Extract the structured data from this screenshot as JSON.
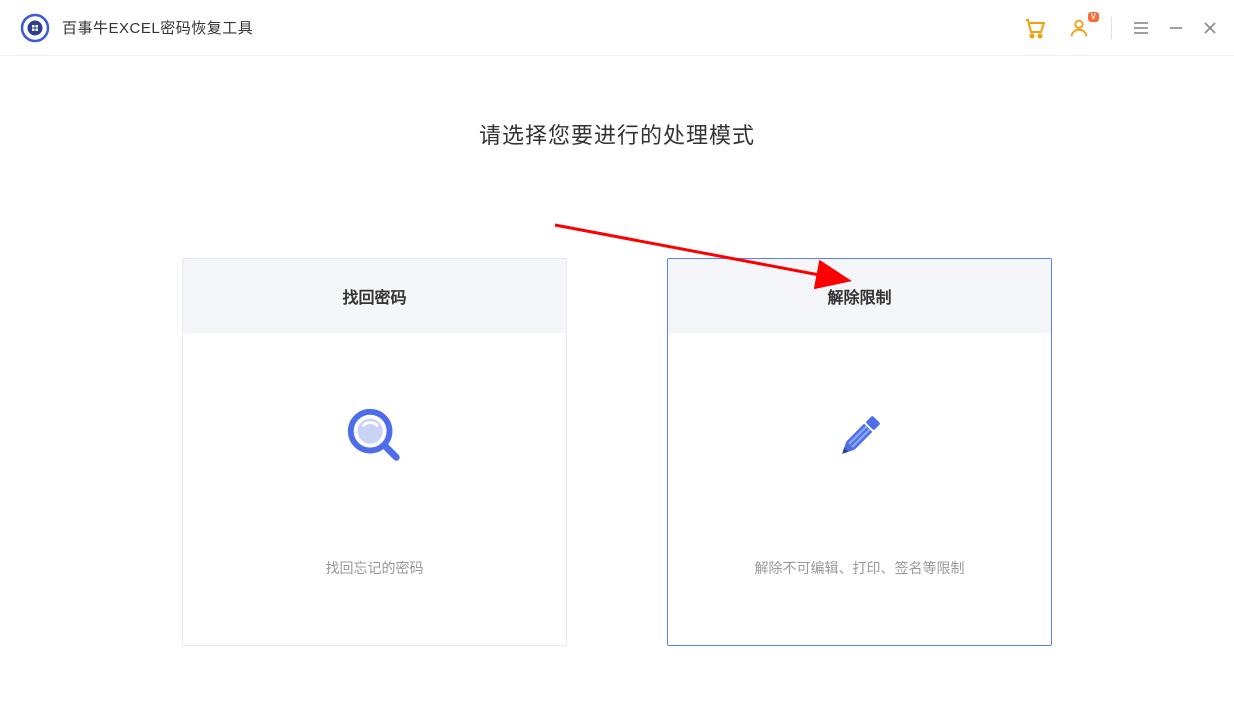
{
  "header": {
    "app_title": "百事牛EXCEL密码恢复工具",
    "user_badge": "V"
  },
  "main": {
    "heading": "请选择您要进行的处理模式",
    "cards": [
      {
        "title": "找回密码",
        "description": "找回忘记的密码"
      },
      {
        "title": "解除限制",
        "description": "解除不可编辑、打印、签名等限制"
      }
    ]
  },
  "colors": {
    "accent_blue": "#4d6ee8",
    "accent_orange": "#f59e0b",
    "annotation_red": "#ff0000"
  }
}
